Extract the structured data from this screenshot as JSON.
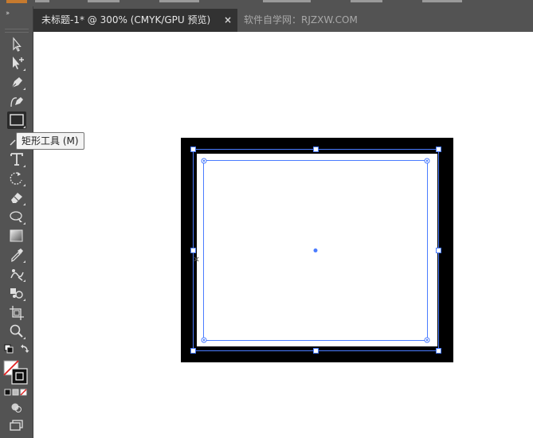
{
  "document_tab": {
    "title": "未标题-1* @ 300% (CMYK/GPU 预览)",
    "close_glyph": "×"
  },
  "watermark_tab": {
    "text": "软件自学网：RJZXW.COM"
  },
  "toolbar": {
    "collapse_glyph": "››",
    "tools": [
      {
        "name": "selection-tool",
        "icon": "arrow-outline-icon"
      },
      {
        "name": "direct-selection-tool",
        "icon": "arrow-plus-icon"
      },
      {
        "name": "pen-tool",
        "icon": "pen-icon"
      },
      {
        "name": "curvature-tool",
        "icon": "curvature-pen-icon"
      },
      {
        "name": "rectangle-tool",
        "icon": "rectangle-icon",
        "selected": true
      },
      {
        "name": "type-tool",
        "icon": "type-T-icon"
      },
      {
        "name": "rotate-tool",
        "icon": "rotate-icon"
      },
      {
        "name": "eraser-tool",
        "icon": "eraser-icon"
      },
      {
        "name": "warp-tool",
        "icon": "warp-icon"
      },
      {
        "name": "gradient-tool",
        "icon": "gradient-icon"
      },
      {
        "name": "eyedropper-tool",
        "icon": "eyedropper-icon"
      },
      {
        "name": "puppet-warp-tool",
        "icon": "puppet-warp-icon"
      },
      {
        "name": "symbol-sprayer-tool",
        "icon": "symbol-sprayer-icon"
      },
      {
        "name": "artboard-tool",
        "icon": "artboard-icon"
      },
      {
        "name": "zoom-tool",
        "icon": "zoom-icon"
      }
    ]
  },
  "tooltip": {
    "text": "矩形工具 (M)"
  },
  "colors": {
    "ui_dark": "#535353",
    "tab_active": "#323232",
    "selection_blue": "#4a7cff",
    "stroke_black": "#000000"
  }
}
